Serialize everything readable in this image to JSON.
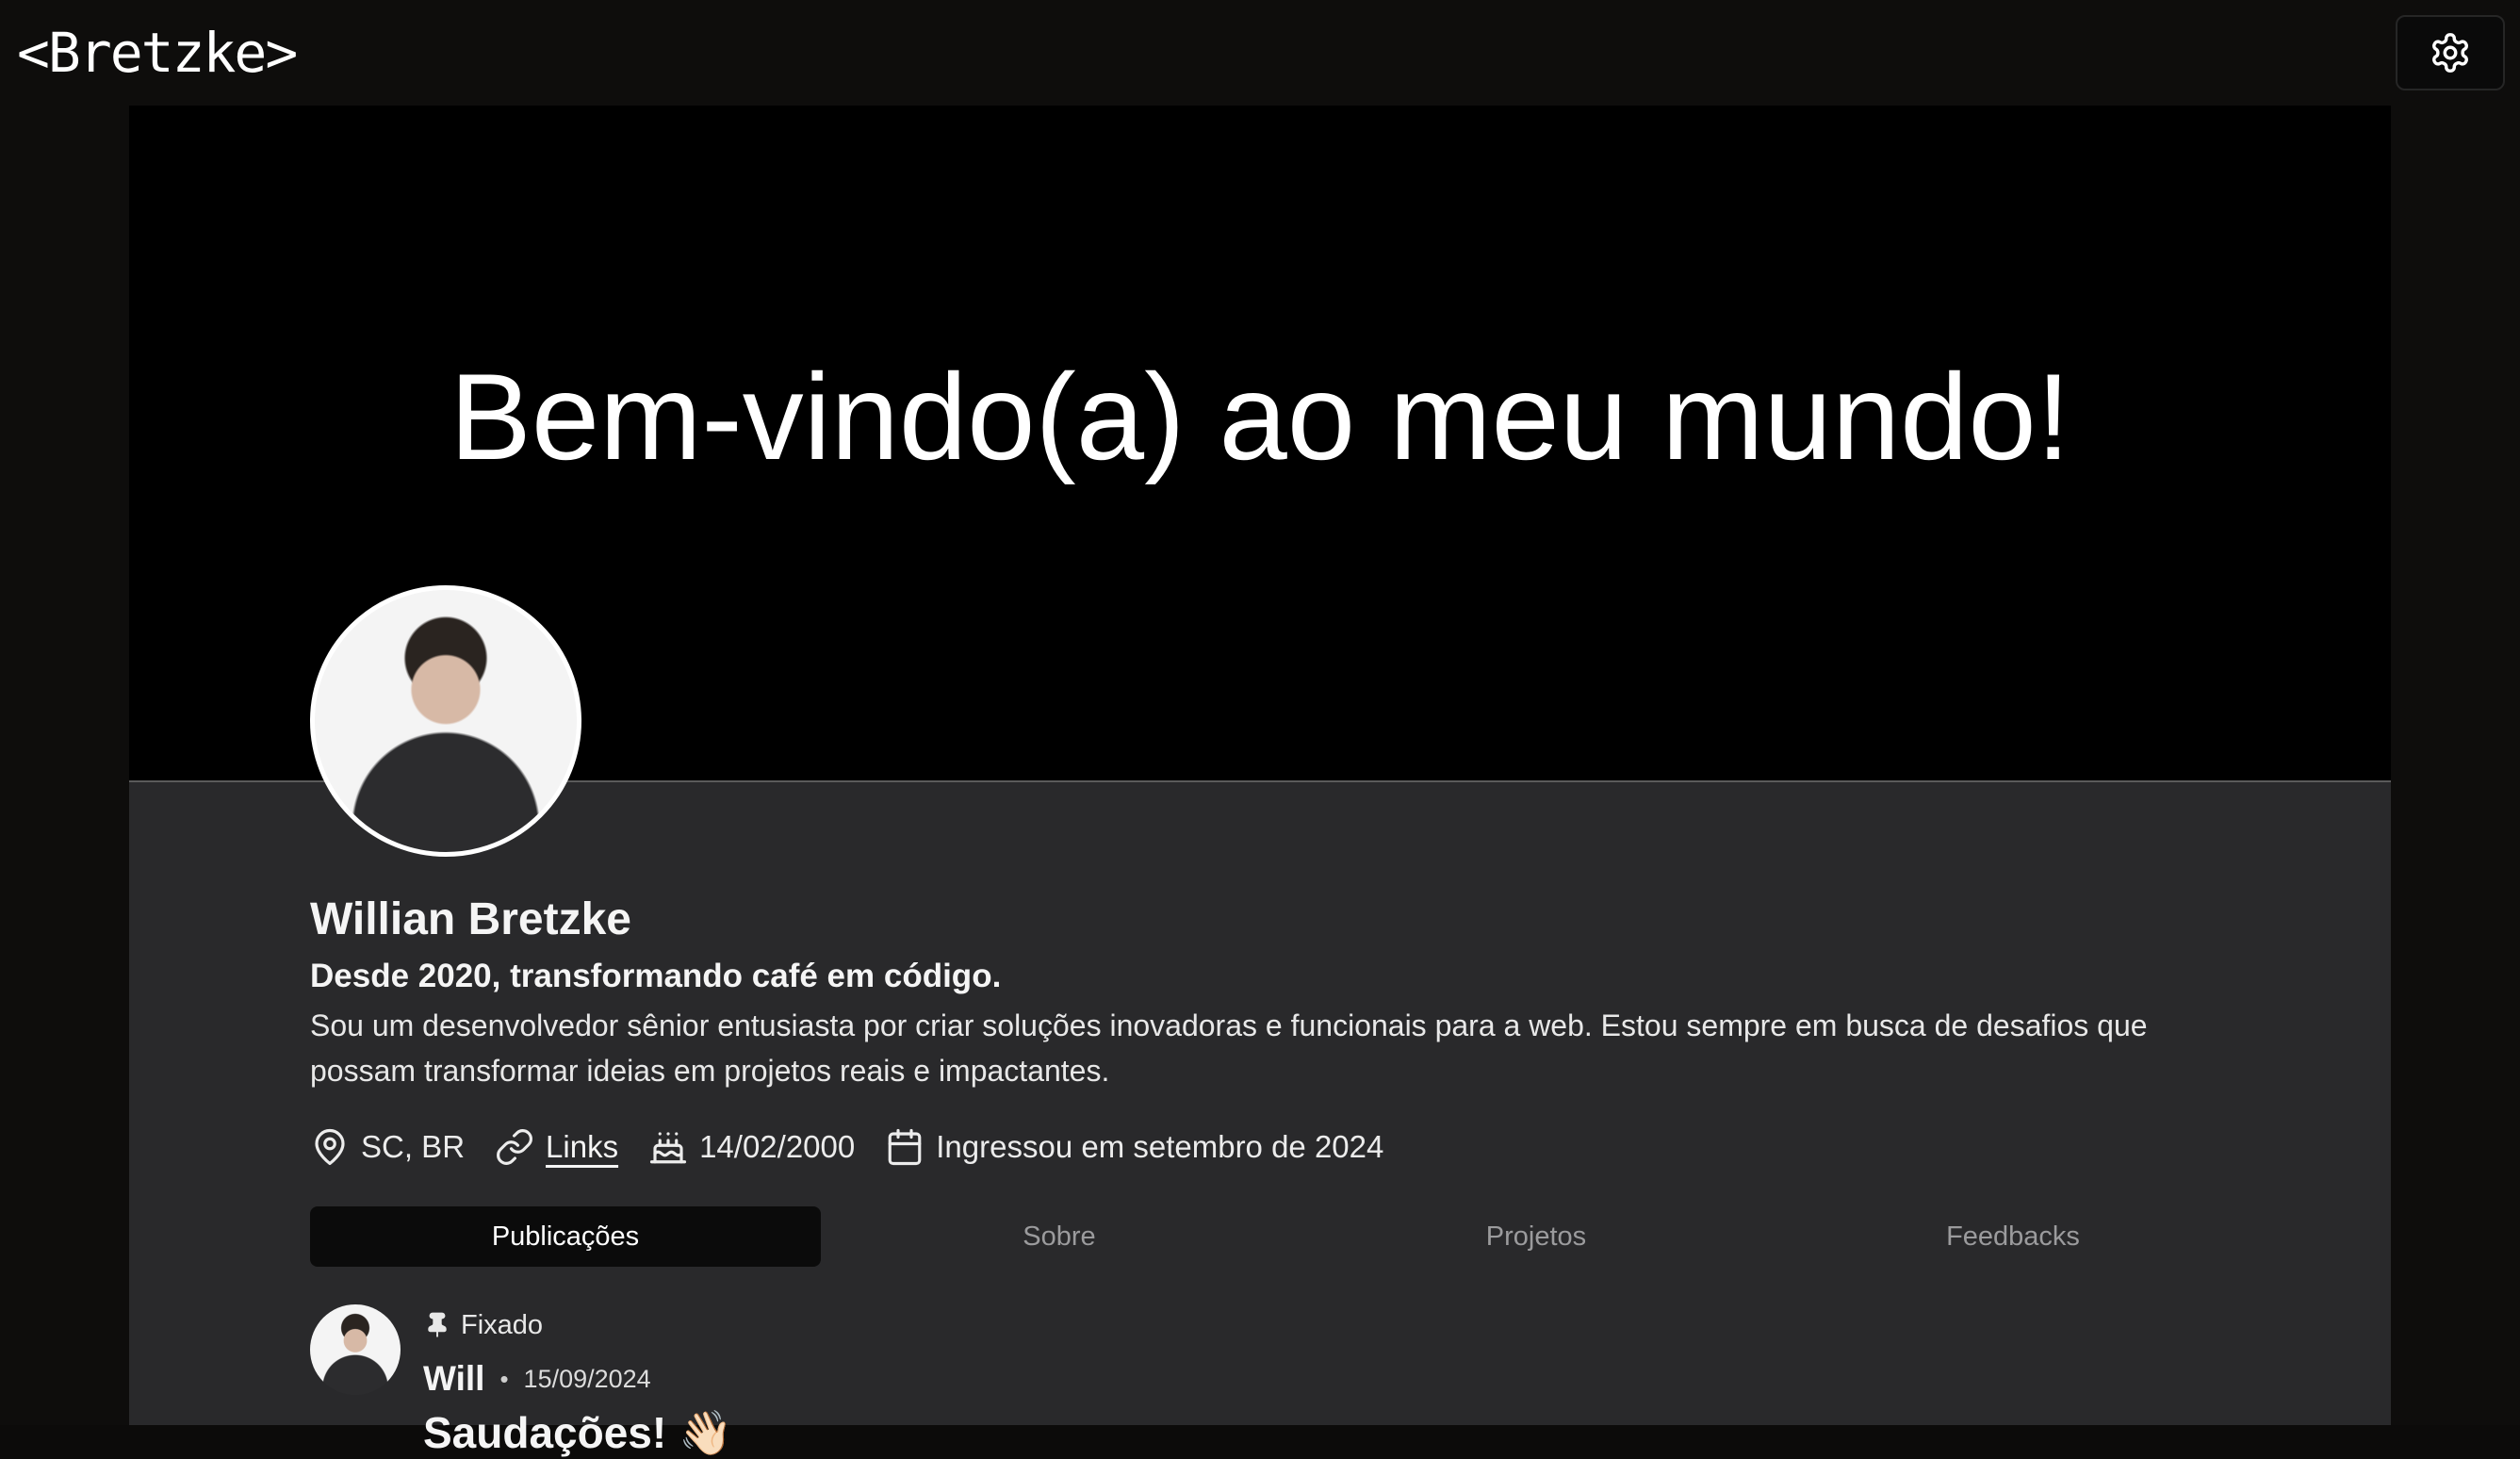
{
  "header": {
    "logo": "<Bretzke>",
    "settings_icon": "gear-icon"
  },
  "banner": {
    "headline": "Bem-vindo(a) ao meu mundo!"
  },
  "profile": {
    "name": "Willian Bretzke",
    "tagline": "Desde 2020, transformando café em código.",
    "bio": "Sou um desenvolvedor sênior entusiasta por criar soluções inovadoras e funcionais para a web. Estou sempre em busca de desafios que possam transformar ideias em projetos reais e impactantes.",
    "meta": {
      "location": "SC, BR",
      "links_label": "Links",
      "birthday": "14/02/2000",
      "joined": "Ingressou em setembro de 2024"
    }
  },
  "tabs": [
    {
      "label": "Publicações",
      "active": true
    },
    {
      "label": "Sobre",
      "active": false
    },
    {
      "label": "Projetos",
      "active": false
    },
    {
      "label": "Feedbacks",
      "active": false
    }
  ],
  "post": {
    "pinned_label": "Fixado",
    "author": "Will",
    "separator": "•",
    "date": "15/09/2024",
    "title": "Saudações! 👋🏻"
  }
}
